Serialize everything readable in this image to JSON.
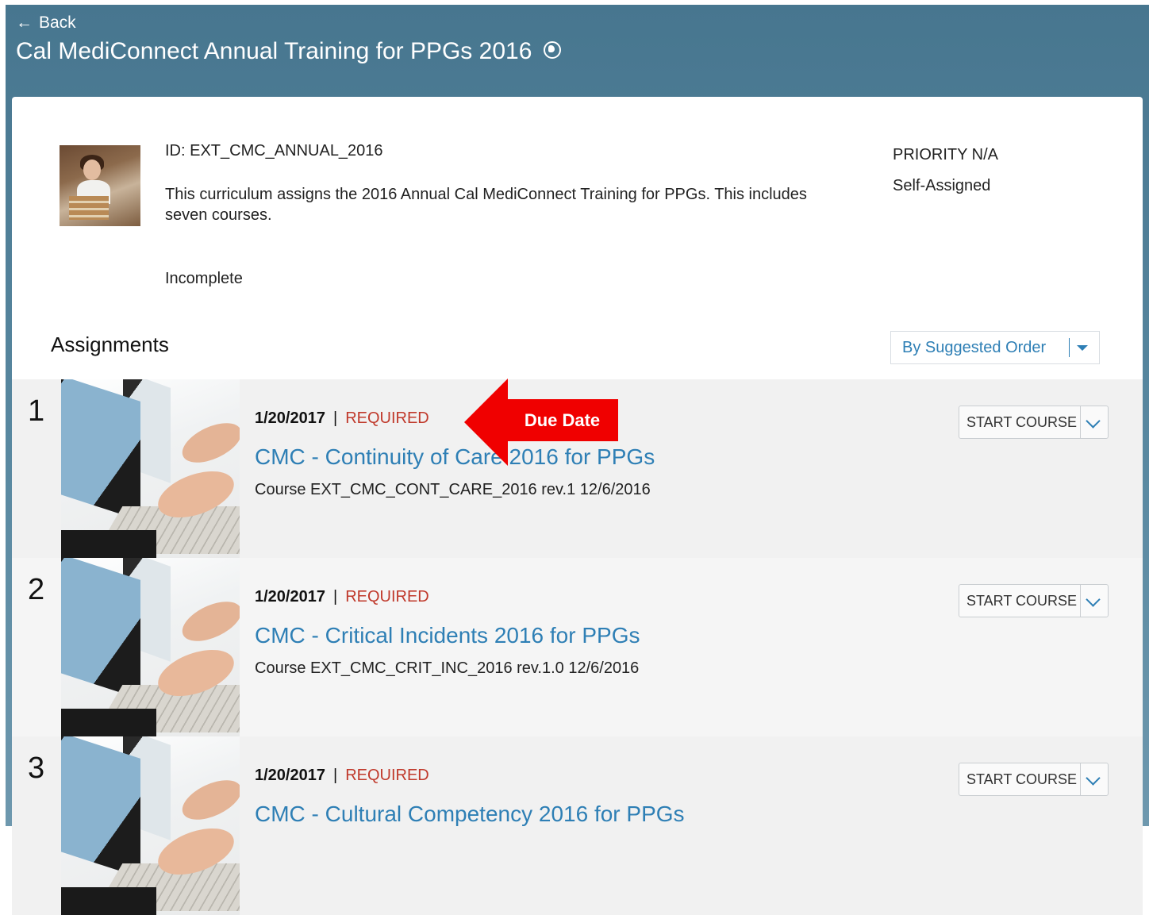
{
  "header": {
    "back_label": "Back",
    "back_arrow": "←",
    "title": "Cal MediConnect Annual Training for PPGs 2016"
  },
  "curriculum": {
    "id_text": "ID: EXT_CMC_ANNUAL_2016",
    "description": "This curriculum assigns the 2016 Annual Cal MediConnect Training for PPGs. This includes seven courses.",
    "status": "Incomplete",
    "priority": "PRIORITY N/A",
    "assignment_type": "Self-Assigned"
  },
  "assignments": {
    "heading": "Assignments",
    "sort_label": "By Suggested Order",
    "items": [
      {
        "number": "1",
        "due_date": "1/20/2017",
        "separator": "|",
        "required": "REQUIRED",
        "title": "CMC - Continuity of Care 2016 for PPGs",
        "info": "Course EXT_CMC_CONT_CARE_2016 rev.1 12/6/2016",
        "action": "START COURSE"
      },
      {
        "number": "2",
        "due_date": "1/20/2017",
        "separator": "|",
        "required": "REQUIRED",
        "title": "CMC - Critical Incidents 2016 for PPGs",
        "info": "Course EXT_CMC_CRIT_INC_2016 rev.1.0 12/6/2016",
        "action": "START COURSE"
      },
      {
        "number": "3",
        "due_date": "1/20/2017",
        "separator": "|",
        "required": "REQUIRED",
        "title": "CMC - Cultural Competency 2016 for PPGs",
        "info": "",
        "action": "START COURSE"
      }
    ]
  },
  "annotation": {
    "label": "Due Date",
    "color": "#f00000"
  },
  "colors": {
    "link": "#2e7fb5",
    "required": "#c0392b",
    "header_bg": "#5b8aa2"
  }
}
